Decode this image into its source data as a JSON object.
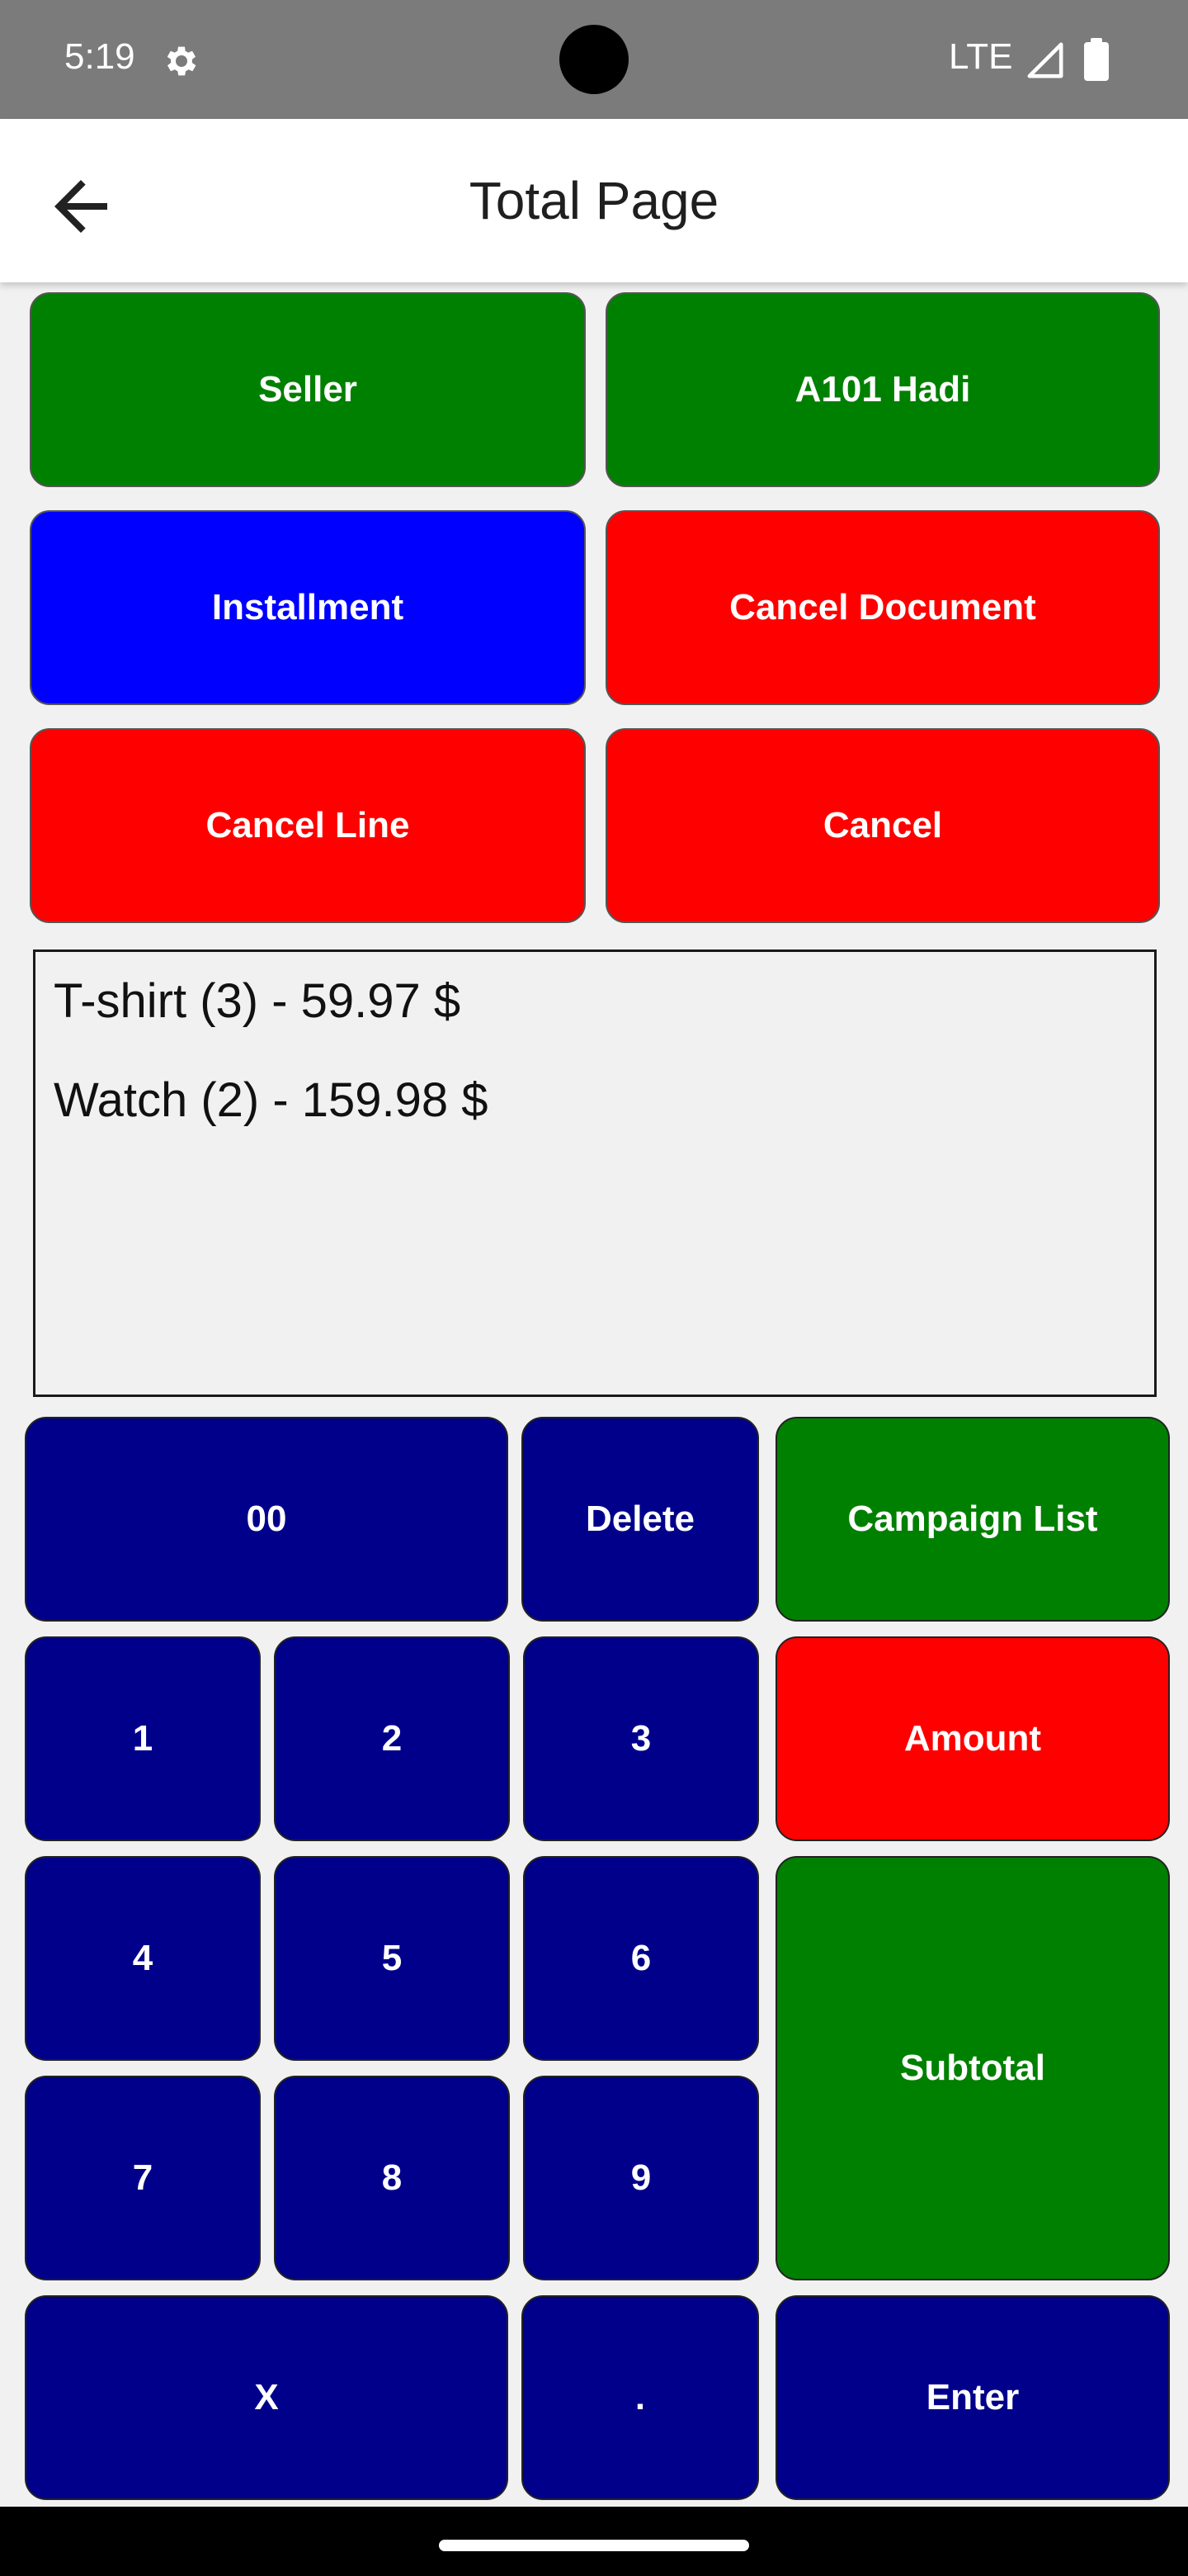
{
  "status_bar": {
    "time": "5:19",
    "network": "LTE",
    "icons": [
      "gear-icon",
      "signal-icon",
      "battery-icon"
    ]
  },
  "app_bar": {
    "title": "Total Page",
    "back_icon": "arrow-left-icon"
  },
  "action_buttons": {
    "seller": "Seller",
    "seller_name": "A101 Hadi",
    "installment": "Installment",
    "cancel_document": "Cancel Document",
    "cancel_line": "Cancel Line",
    "cancel": "Cancel"
  },
  "cart_items": [
    "T-shirt (3) - 59.97 $",
    "Watch (2) - 159.98 $"
  ],
  "keypad": {
    "double_zero": "00",
    "delete": "Delete",
    "campaign_list": "Campaign List",
    "digits": [
      "1",
      "2",
      "3",
      "4",
      "5",
      "6",
      "7",
      "8",
      "9"
    ],
    "amount": "Amount",
    "subtotal": "Subtotal",
    "multiply": "X",
    "decimal": ".",
    "enter": "Enter"
  },
  "colors": {
    "green": "#008000",
    "red": "#ff0000",
    "blue": "#0000ff",
    "navy": "#00008b",
    "status_bar": "#7b7b7b",
    "background": "#f1f1f1"
  }
}
